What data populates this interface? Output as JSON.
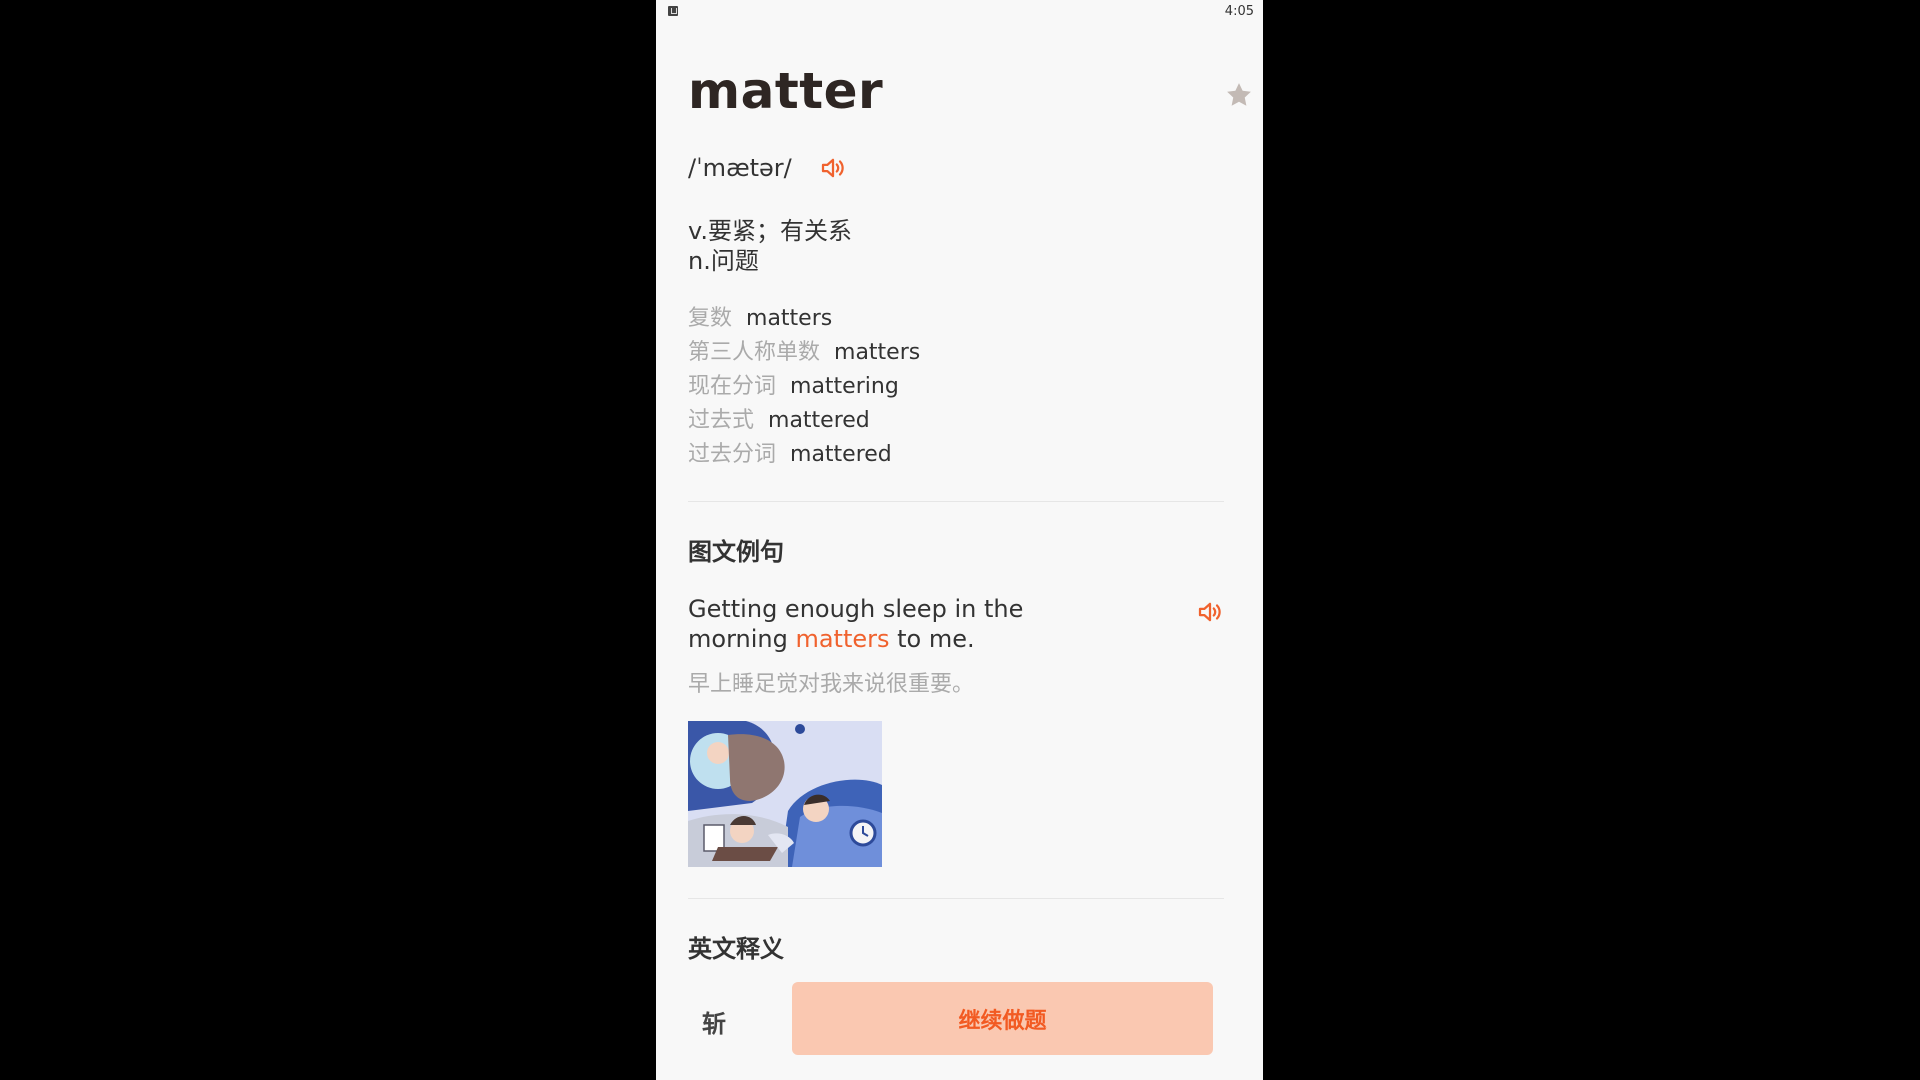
{
  "status_bar": {
    "time": "4:05"
  },
  "word": {
    "headword": "matter",
    "phonetic": "/ˈmætər/",
    "definitions": [
      "v.要紧；有关系",
      "n.问题"
    ],
    "forms": [
      {
        "label": "复数",
        "value": "matters"
      },
      {
        "label": "第三人称单数",
        "value": "matters"
      },
      {
        "label": "现在分词",
        "value": "mattering"
      },
      {
        "label": "过去式",
        "value": "mattered"
      },
      {
        "label": "过去分词",
        "value": "mattered"
      }
    ]
  },
  "sections": {
    "example_title": "图文例句",
    "english_def_title": "英文释义"
  },
  "example": {
    "sentence_before": "Getting enough sleep in the morning ",
    "highlight": "matters",
    "sentence_after": " to me.",
    "translation": "早上睡足觉对我来说很重要。"
  },
  "actions": {
    "slash_label": "斩",
    "continue_label": "继续做题"
  },
  "colors": {
    "accent": "#f0622e",
    "button_bg": "#fac8b1",
    "star": "#c3bab5"
  },
  "icons": [
    "star-icon",
    "speaker-icon",
    "notification-icon"
  ]
}
